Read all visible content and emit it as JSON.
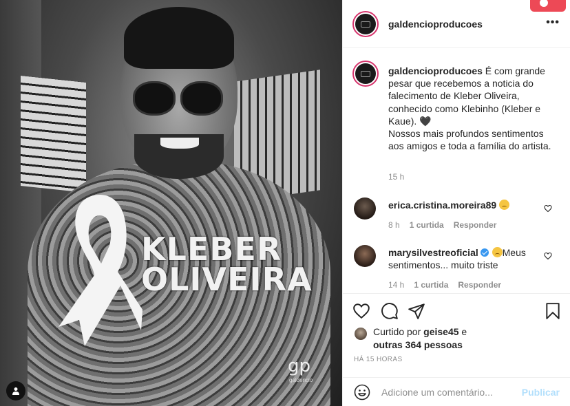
{
  "post": {
    "image_name_line1": "KLEBER",
    "image_name_line2": "OLIVEIRA",
    "image_logo": "gp",
    "image_logo_sub": "galdencio"
  },
  "header": {
    "username": "galdencioproducoes",
    "more_label": "•••"
  },
  "caption": {
    "username": "galdencioproducoes",
    "text": " É com grande pesar que recebemos a noticia do falecimento de Kleber Oliveira, conhecido como Klebinho (Kleber e Kaue). 🖤\nNossos mais profundos sentimentos aos amigos e toda a família do artista.",
    "time": "15 h"
  },
  "comments": [
    {
      "username": "erica.cristina.moreira89",
      "text": "",
      "time": "8 h",
      "likes": "1 curtida",
      "reply": "Responder"
    },
    {
      "username": "marysilvestreoficial",
      "text": "Meus sentimentos... muito triste",
      "time": "14 h",
      "likes": "1 curtida",
      "reply": "Responder"
    }
  ],
  "likes": {
    "prefix": "Curtido por ",
    "user": "geise45",
    "mid": " e",
    "others": "outras 364 pessoas"
  },
  "timestamp": "HÁ 15 HORAS",
  "add_comment": {
    "placeholder": "Adicione um comentário...",
    "publish": "Publicar"
  },
  "colors": {
    "accent": "#ed4956",
    "link_disabled": "#b2dffc",
    "verified": "#3897f0"
  }
}
